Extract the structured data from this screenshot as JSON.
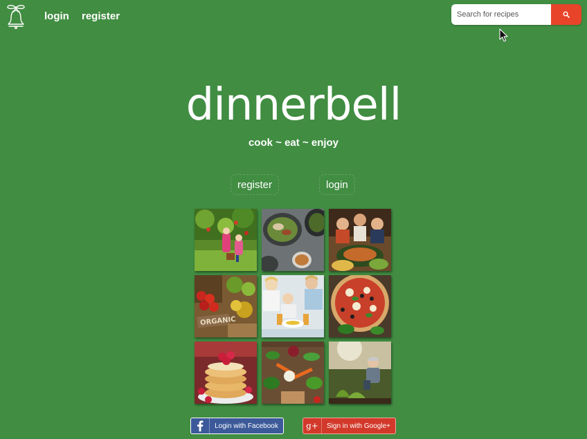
{
  "header": {
    "login_label": "login",
    "register_label": "register",
    "search": {
      "placeholder": "Search for recipes"
    }
  },
  "hero": {
    "title": "dinnerbell",
    "tagline": "cook ~ eat ~ enjoy",
    "register_label": "register",
    "login_label": "login"
  },
  "gallery": {
    "tiles": [
      {
        "icon": "apple-orchard-photo"
      },
      {
        "icon": "salad-bowls-photo"
      },
      {
        "icon": "family-dinner-photo"
      },
      {
        "icon": "organic-produce-photo"
      },
      {
        "icon": "family-breakfast-photo"
      },
      {
        "icon": "pizza-photo"
      },
      {
        "icon": "raspberry-pancakes-photo"
      },
      {
        "icon": "vegetables-table-photo"
      },
      {
        "icon": "gardening-photo"
      }
    ]
  },
  "social": {
    "facebook_label": "Login with Facebook",
    "google_label": "Sign in with Google+",
    "google_glyph": "g+"
  },
  "colors": {
    "background": "#418d42",
    "search_button": "#e8442a",
    "facebook": "#3c5a9a",
    "google": "#d2392a"
  }
}
